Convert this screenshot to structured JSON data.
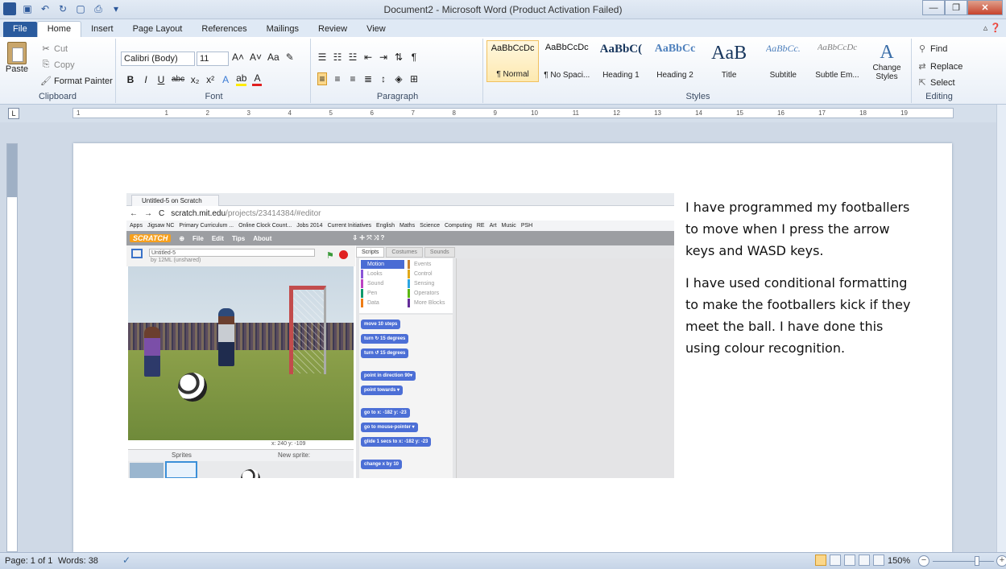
{
  "window": {
    "title": "Document2 - Microsoft Word (Product Activation Failed)",
    "controls": [
      "minimize",
      "restore",
      "close"
    ]
  },
  "ribbon_tabs": [
    "File",
    "Home",
    "Insert",
    "Page Layout",
    "References",
    "Mailings",
    "Review",
    "View"
  ],
  "active_tab": "Home",
  "clipboard": {
    "paste_label": "Paste",
    "cut_label": "Cut",
    "copy_label": "Copy",
    "format_painter_label": "Format Painter",
    "group_label": "Clipboard"
  },
  "font": {
    "name": "Calibri (Body)",
    "size": "11",
    "bold": "B",
    "italic": "I",
    "underline": "U",
    "strike": "abc",
    "subscript": "x₂",
    "superscript": "x²",
    "group_label": "Font"
  },
  "paragraph": {
    "group_label": "Paragraph"
  },
  "styles": {
    "items": [
      {
        "sample": "AaBbCcDc",
        "name": "¶ Normal",
        "selected": true
      },
      {
        "sample": "AaBbCcDc",
        "name": "¶ No Spaci...",
        "selected": false
      },
      {
        "sample": "AaBbC(",
        "name": "Heading 1",
        "selected": false
      },
      {
        "sample": "AaBbCc",
        "name": "Heading 2",
        "selected": false
      },
      {
        "sample": "AaB",
        "name": "Title",
        "selected": false
      },
      {
        "sample": "AaBbCc.",
        "name": "Subtitle",
        "selected": false
      },
      {
        "sample": "AaBbCcDc",
        "name": "Subtle Em...",
        "selected": false
      }
    ],
    "change_styles_label": "Change Styles",
    "group_label": "Styles"
  },
  "editing": {
    "find_label": "Find",
    "replace_label": "Replace",
    "select_label": "Select",
    "group_label": "Editing"
  },
  "ruler_numbers": [
    "1",
    "1",
    "2",
    "3",
    "4",
    "5",
    "6",
    "7",
    "8",
    "9",
    "10",
    "11",
    "12",
    "13",
    "14",
    "15",
    "16",
    "17",
    "18",
    "19"
  ],
  "document": {
    "paragraphs": [
      "I have programmed my footballers to move when I press the arrow keys and WASD keys.",
      "I have used conditional formatting to make the footballers kick if they meet the ball. I have done this using colour recognition."
    ]
  },
  "embedded_screenshot": {
    "browser_tab": "Untitled-5 on Scratch",
    "url_host": "scratch.mit.edu",
    "url_path": "/projects/23414384/#editor",
    "bookmarks": [
      "Apps",
      "Jigsaw NC",
      "Primary Curriculum ...",
      "Online Clock Count...",
      "Jobs 2014",
      "Current Initiatives",
      "English",
      "Maths",
      "Science",
      "Computing",
      "RE",
      "Art",
      "Music",
      "PSH"
    ],
    "menu": [
      "File",
      "Edit",
      "Tips",
      "About"
    ],
    "project_name": "Untitled-5",
    "project_by": "by 12ML (unshared)",
    "tabs": [
      "Scripts",
      "Costumes",
      "Sounds"
    ],
    "categories": [
      {
        "name": "Motion",
        "color": "#4a6cd4"
      },
      {
        "name": "Events",
        "color": "#c88330"
      },
      {
        "name": "Looks",
        "color": "#8a55d7"
      },
      {
        "name": "Control",
        "color": "#e1a91a"
      },
      {
        "name": "Sound",
        "color": "#bb42c3"
      },
      {
        "name": "Sensing",
        "color": "#2ca5e2"
      },
      {
        "name": "Pen",
        "color": "#0e9a6c"
      },
      {
        "name": "Operators",
        "color": "#5cb712"
      },
      {
        "name": "Data",
        "color": "#ee7d16"
      },
      {
        "name": "More Blocks",
        "color": "#632d99"
      }
    ],
    "blocks": [
      "move 10 steps",
      "turn ↻ 15 degrees",
      "turn ↺ 15 degrees",
      "point in direction 90▾",
      "point towards ▾",
      "go to x: -182 y: -23",
      "go to mouse-pointer ▾",
      "glide 1 secs to x: -182 y: -23",
      "change x by 10"
    ],
    "stage_coords": "x: 240  y: -109",
    "sprites_label": "Sprites",
    "new_sprite_label": "New sprite:"
  },
  "status": {
    "page": "Page: 1 of 1",
    "words": "Words: 38",
    "zoom": "150%"
  }
}
